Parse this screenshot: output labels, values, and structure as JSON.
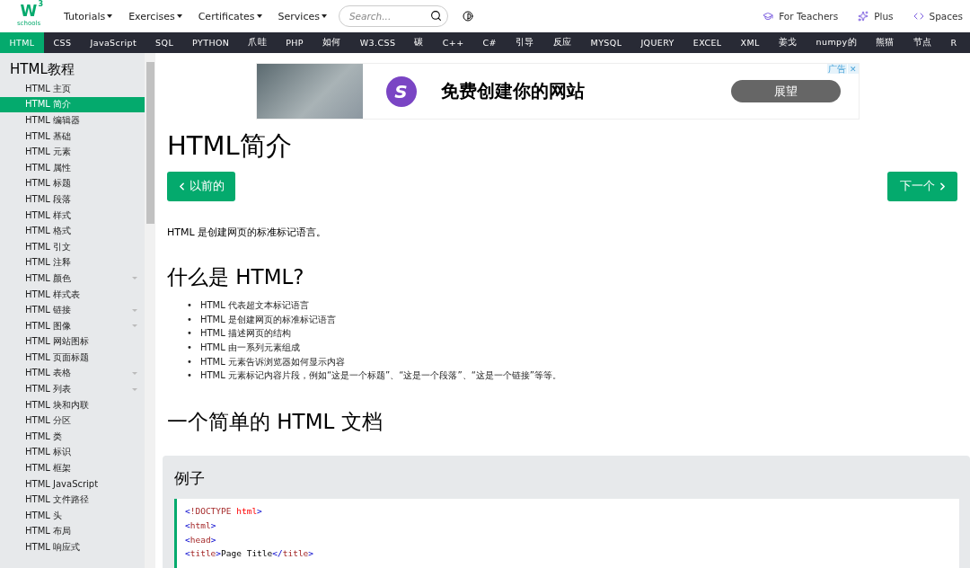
{
  "header": {
    "logo": {
      "mark": "W",
      "sup": "3",
      "sub": "schools"
    },
    "menus": [
      "Tutorials",
      "Exercises",
      "Certificates",
      "Services"
    ],
    "search": {
      "placeholder": "Search..."
    },
    "links": [
      {
        "kind": "teachers",
        "label": "For Teachers"
      },
      {
        "kind": "plus",
        "label": "Plus"
      },
      {
        "kind": "spaces",
        "label": "Spaces"
      }
    ]
  },
  "topnav": [
    {
      "label": "HTML",
      "selected": true
    },
    {
      "label": "CSS",
      "selected": false
    },
    {
      "label": "JavaScript",
      "selected": false
    },
    {
      "label": "SQL",
      "selected": false
    },
    {
      "label": "PYTHON",
      "selected": false
    },
    {
      "label": "爪哇",
      "selected": false
    },
    {
      "label": "PHP",
      "selected": false
    },
    {
      "label": "如何",
      "selected": false
    },
    {
      "label": "W3.CSS",
      "selected": false
    },
    {
      "label": "碳",
      "selected": false
    },
    {
      "label": "C++",
      "selected": false
    },
    {
      "label": "C#",
      "selected": false
    },
    {
      "label": "引导",
      "selected": false
    },
    {
      "label": "反应",
      "selected": false
    },
    {
      "label": "MYSQL",
      "selected": false
    },
    {
      "label": "JQUERY",
      "selected": false
    },
    {
      "label": "EXCEL",
      "selected": false
    },
    {
      "label": "XML",
      "selected": false
    },
    {
      "label": "姜戈",
      "selected": false
    },
    {
      "label": "numpy的",
      "selected": false
    },
    {
      "label": "熊猫",
      "selected": false
    },
    {
      "label": "节点",
      "selected": false
    },
    {
      "label": "R",
      "selected": false
    }
  ],
  "sidebar": {
    "title": "HTML教程",
    "items": [
      {
        "label": "HTML 主页",
        "selected": false,
        "expandable": false
      },
      {
        "label": "HTML 简介",
        "selected": true,
        "expandable": false
      },
      {
        "label": "HTML 编辑器",
        "selected": false,
        "expandable": false
      },
      {
        "label": "HTML 基础",
        "selected": false,
        "expandable": false
      },
      {
        "label": "HTML 元素",
        "selected": false,
        "expandable": false
      },
      {
        "label": "HTML 属性",
        "selected": false,
        "expandable": false
      },
      {
        "label": "HTML 标题",
        "selected": false,
        "expandable": false
      },
      {
        "label": "HTML 段落",
        "selected": false,
        "expandable": false
      },
      {
        "label": "HTML 样式",
        "selected": false,
        "expandable": false
      },
      {
        "label": "HTML 格式",
        "selected": false,
        "expandable": false
      },
      {
        "label": "HTML 引文",
        "selected": false,
        "expandable": false
      },
      {
        "label": "HTML 注释",
        "selected": false,
        "expandable": false
      },
      {
        "label": "HTML 颜色",
        "selected": false,
        "expandable": true
      },
      {
        "label": "HTML 样式表",
        "selected": false,
        "expandable": false
      },
      {
        "label": "HTML 链接",
        "selected": false,
        "expandable": true
      },
      {
        "label": "HTML 图像",
        "selected": false,
        "expandable": true
      },
      {
        "label": "HTML 网站图标",
        "selected": false,
        "expandable": false
      },
      {
        "label": "HTML 页面标题",
        "selected": false,
        "expandable": false
      },
      {
        "label": "HTML 表格",
        "selected": false,
        "expandable": true
      },
      {
        "label": "HTML 列表",
        "selected": false,
        "expandable": true
      },
      {
        "label": "HTML 块和内联",
        "selected": false,
        "expandable": false
      },
      {
        "label": "HTML 分区",
        "selected": false,
        "expandable": false
      },
      {
        "label": "HTML 类",
        "selected": false,
        "expandable": false
      },
      {
        "label": "HTML 标识",
        "selected": false,
        "expandable": false
      },
      {
        "label": "HTML 框架",
        "selected": false,
        "expandable": false
      },
      {
        "label": "HTML JavaScript",
        "selected": false,
        "expandable": false
      },
      {
        "label": "HTML 文件路径",
        "selected": false,
        "expandable": false
      },
      {
        "label": "HTML 头",
        "selected": false,
        "expandable": false
      },
      {
        "label": "HTML 布局",
        "selected": false,
        "expandable": false
      },
      {
        "label": "HTML 响应式",
        "selected": false,
        "expandable": false
      }
    ]
  },
  "ad": {
    "label": "广告",
    "headline": "免费创建你的网站",
    "logo": "S",
    "button": "展望",
    "close": "✕"
  },
  "content": {
    "title": "HTML简介",
    "prev": "以前的",
    "next": "下一个",
    "intro": "HTML 是创建网页的标准标记语言。",
    "section1": {
      "heading": "什么是 HTML?",
      "marker": "•",
      "bullets": [
        "HTML 代表超文本标记语言",
        "HTML 是创建网页的标准标记语言",
        "HTML 描述网页的结构",
        "HTML 由一系列元素组成",
        "HTML 元素告诉浏览器如何显示内容",
        "HTML 元素标记内容片段，例如“这是一个标题”、“这是一个段落”、“这是一个链接”等等。"
      ]
    },
    "section2": {
      "heading": "一个简单的 HTML 文档"
    },
    "example": {
      "title": "例子",
      "code": [
        [
          {
            "kind": "bracket",
            "text": "<"
          },
          {
            "kind": "tag",
            "text": "!DOCTYPE "
          },
          {
            "kind": "attr",
            "text": "html"
          },
          {
            "kind": "bracket",
            "text": ">"
          }
        ],
        [
          {
            "kind": "bracket",
            "text": "<"
          },
          {
            "kind": "tag",
            "text": "html"
          },
          {
            "kind": "bracket",
            "text": ">"
          }
        ],
        [
          {
            "kind": "bracket",
            "text": "<"
          },
          {
            "kind": "tag",
            "text": "head"
          },
          {
            "kind": "bracket",
            "text": ">"
          }
        ],
        [
          {
            "kind": "bracket",
            "text": "<"
          },
          {
            "kind": "tag",
            "text": "title"
          },
          {
            "kind": "bracket",
            "text": ">"
          },
          {
            "kind": "text",
            "text": "Page Title"
          },
          {
            "kind": "bracket",
            "text": "</"
          },
          {
            "kind": "tag",
            "text": "title"
          },
          {
            "kind": "bracket",
            "text": ">"
          }
        ]
      ]
    }
  }
}
